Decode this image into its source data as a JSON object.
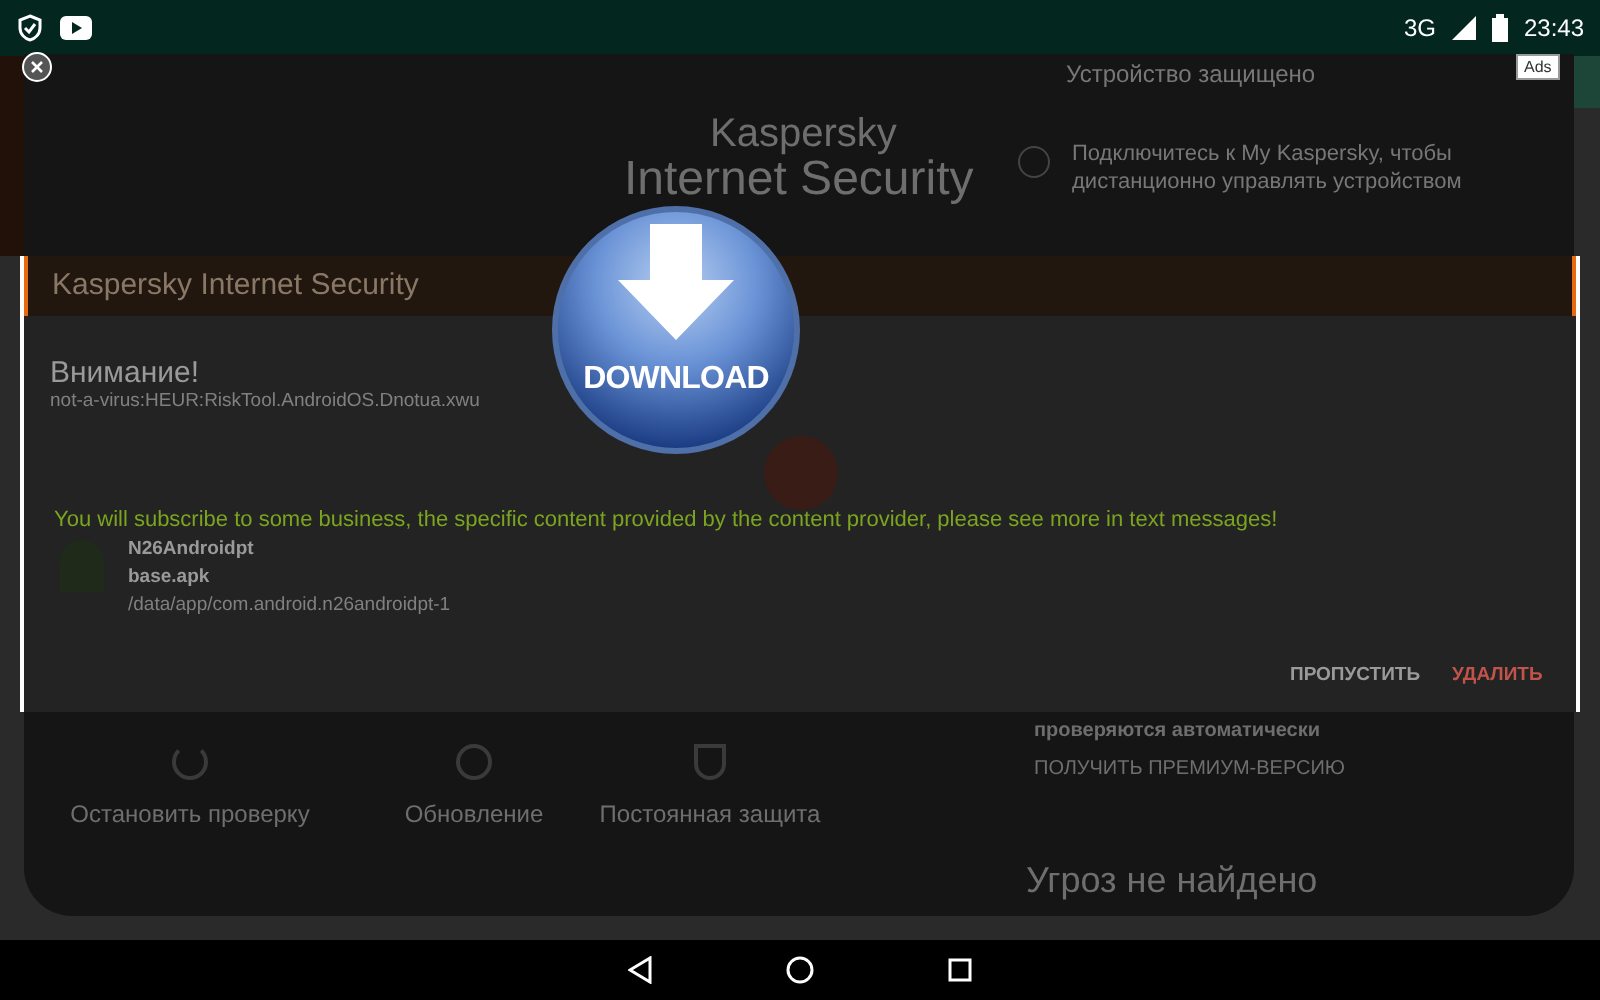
{
  "status_bar": {
    "network": "3G",
    "time": "23:43"
  },
  "background_app": {
    "logo_line_1": "Kaspersky",
    "logo_line_2": "Internet Security",
    "status_title": "Устройство защищено",
    "notice": "Подключитесь к My Kaspersky, чтобы дистанционно управлять устройством",
    "premium_text": "проверяются автоматически",
    "premium_link": "ПОЛУЧИТЬ ПРЕМИУМ-ВЕРСИЮ",
    "scan_result": "Угроз не найдено",
    "actions": [
      {
        "label": "Остановить проверку",
        "kind": "stop"
      },
      {
        "label": "Обновление",
        "kind": "update"
      },
      {
        "label": "Постоянная защита",
        "kind": "shield"
      }
    ]
  },
  "dialog": {
    "title": "Kaspersky Internet Security",
    "heading": "Внимание!",
    "threat": "not-a-virus:HEUR:RiskTool.AndroidOS.Dnotua.xwu",
    "app_name": "N26Androidpt",
    "file": "base.apk",
    "path": "/data/app/com.android.n26androidpt-1",
    "buttons": [
      {
        "label": "ПРОПУСТИТЬ",
        "kind": "skip"
      },
      {
        "label": "УДАЛИТЬ",
        "kind": "delete"
      }
    ]
  },
  "ad": {
    "badge": "Ads",
    "download_label": "DOWNLOAD",
    "message": "You will subscribe to some business, the specific content provided by the content provider, please see more in text messages!"
  }
}
